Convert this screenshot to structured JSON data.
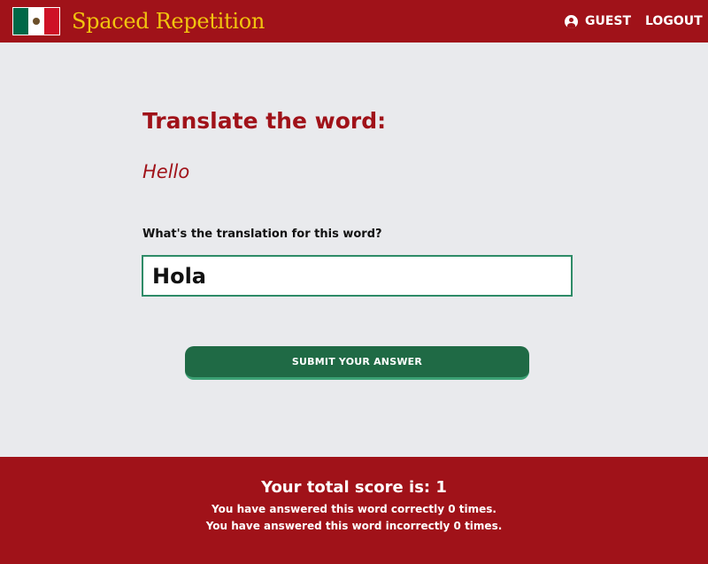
{
  "header": {
    "brand": "Spaced Repetition",
    "user_label": "GUEST",
    "logout_label": "LOGOUT",
    "flag_colors": [
      "#006847",
      "#ffffff",
      "#ce1126"
    ]
  },
  "main": {
    "title": "Translate the word:",
    "word": "Hello",
    "prompt": "What's the translation for this word?",
    "answer_value": "Hola",
    "submit_label": "SUBMIT YOUR ANSWER"
  },
  "footer": {
    "score_label": "Your total score is:",
    "score": "1",
    "correct_text": "You have answered this word correctly 0 times.",
    "incorrect_text": "You have answered this word incorrectly 0 times."
  },
  "colors": {
    "brand_red": "#a01219",
    "brand_yellow": "#f1c40f",
    "button_green": "#1f6a45",
    "input_border": "#2e8b67",
    "background": "#e9eaed"
  },
  "icons": {
    "user": "user-circle-icon",
    "flag": "mexico-flag-icon"
  }
}
